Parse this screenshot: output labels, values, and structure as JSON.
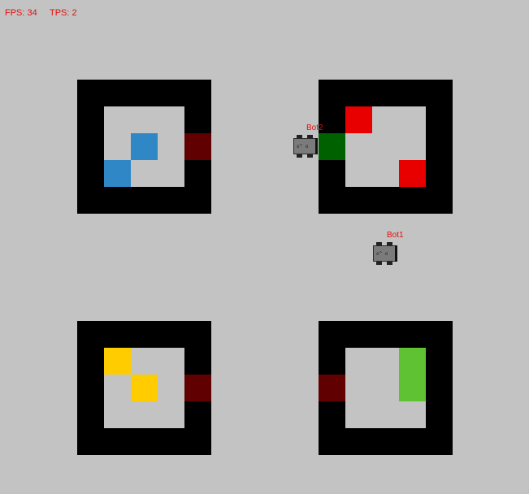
{
  "hud": {
    "fps": "FPS: 34",
    "tps": "TPS: 2"
  },
  "colors": {
    "background": "#c3c3c3",
    "wall": "#000000",
    "door": "#610000",
    "door_open": "#006100",
    "blue": "#2f87c6",
    "red": "#e80000",
    "yellow": "#ffcc00",
    "green": "#5fc232"
  },
  "rooms": [
    {
      "id": "room-top-left",
      "door_side": "right",
      "door_state": "closed",
      "items": [
        "blue",
        "blue"
      ]
    },
    {
      "id": "room-top-right",
      "door_side": "left",
      "door_state": "open",
      "items": [
        "red",
        "red"
      ]
    },
    {
      "id": "room-bottom-left",
      "door_side": "right",
      "door_state": "closed",
      "items": [
        "yellow",
        "yellow"
      ]
    },
    {
      "id": "room-bottom-right",
      "door_side": "left",
      "door_state": "closed",
      "items": [
        "green",
        "green"
      ]
    }
  ],
  "bots": [
    {
      "name": "Bot2",
      "face": "o^ o"
    },
    {
      "name": "Bot1",
      "face": "o^ o"
    }
  ]
}
